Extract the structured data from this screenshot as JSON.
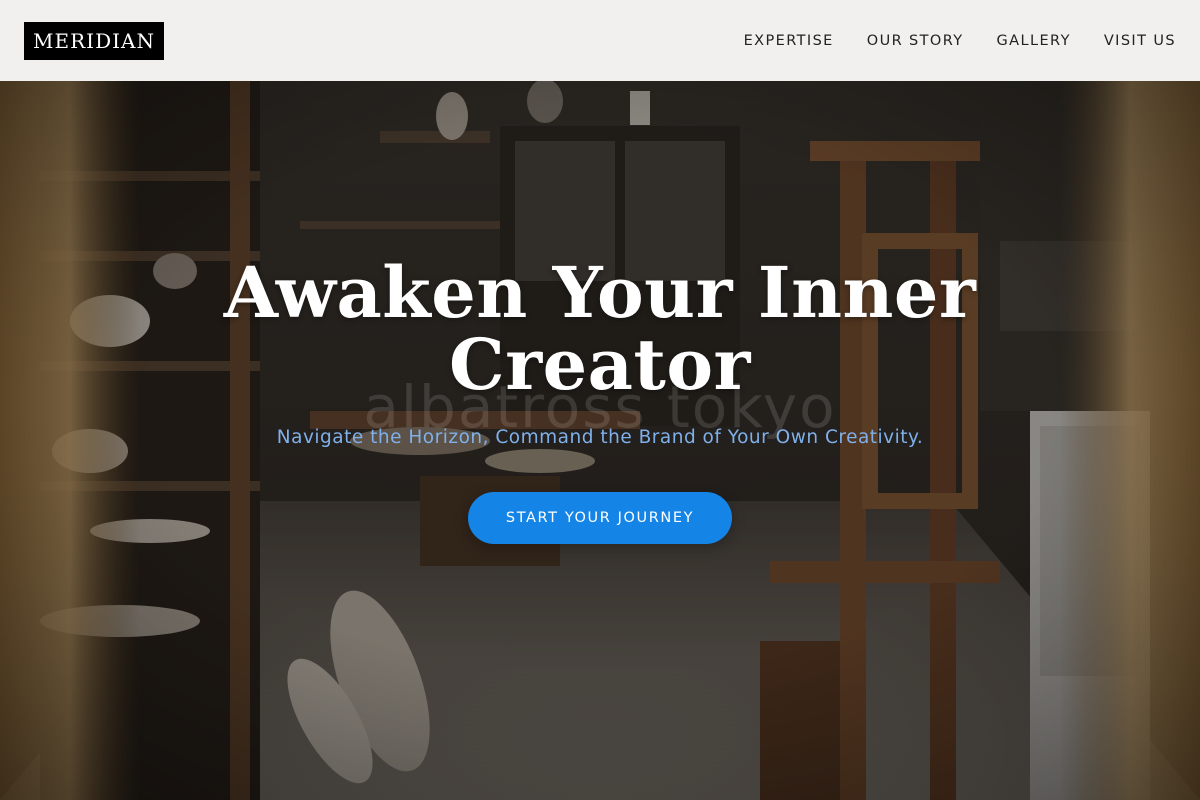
{
  "header": {
    "logo": "MERIDIAN",
    "nav": [
      "EXPERTISE",
      "OUR STORY",
      "GALLERY",
      "VISIT US"
    ]
  },
  "hero": {
    "title_line1": "Awaken Your Inner",
    "title_line2": "Creator",
    "subtitle": "Navigate the Horizon, Command the Brand of Your Own Creativity.",
    "cta": "START YOUR JOURNEY",
    "watermark": "albatross tokyo"
  },
  "colors": {
    "header_bg": "#f1f0ee",
    "logo_bg": "#000000",
    "accent": "#1484e6",
    "subtitle": "#7fb0ea"
  }
}
